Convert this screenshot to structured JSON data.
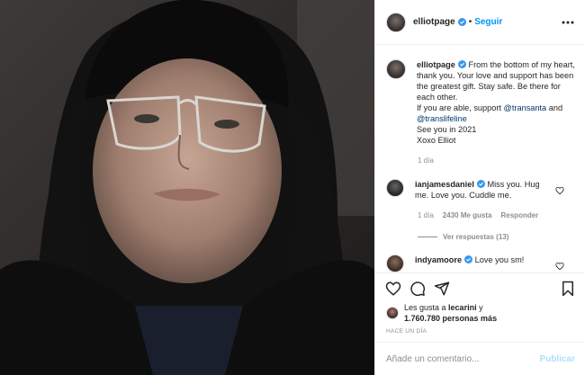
{
  "post": {
    "username": "elliotpage",
    "separator": "•",
    "follow_label": "Seguir"
  },
  "caption": {
    "username": "elliotpage",
    "line1": "From the bottom of my heart, thank you. Your love and support has been the greatest gift. Stay safe. Be there for each other.",
    "line2": "If you are able, support ",
    "mention1": "@transanta",
    "and_word": " and ",
    "mention2": "@translifeline",
    "line3": "See you in 2021",
    "line4": "Xoxo Elliot",
    "time": "1 día"
  },
  "comments": [
    {
      "username": "ianjamesdaniel",
      "text": "Miss you. Hug me. Love you. Cuddle me.",
      "time": "1 día",
      "likes": "2430 Me gusta",
      "reply_label": "Responder",
      "view_replies": "Ver respuestas (13)"
    },
    {
      "username": "indyamoore",
      "text": "Love you sm!"
    }
  ],
  "likes": {
    "prefix": "Les gusta a ",
    "user": "lecarini",
    "joiner": " y",
    "count": "1.760.780 personas más"
  },
  "date_label": "HACE UN DÍA",
  "comment_box": {
    "placeholder": "Añade un comentario...",
    "publish_label": "Publicar"
  },
  "colors": {
    "follow": "#0095f6",
    "verified": "#3897f0",
    "link": "#00376b",
    "meta": "#8e8e8e",
    "publish_disabled": "#b2dffc"
  },
  "icons": {
    "more": "more-icon",
    "like": "heart-icon",
    "comment": "comment-icon",
    "share": "share-icon",
    "save": "bookmark-icon"
  }
}
